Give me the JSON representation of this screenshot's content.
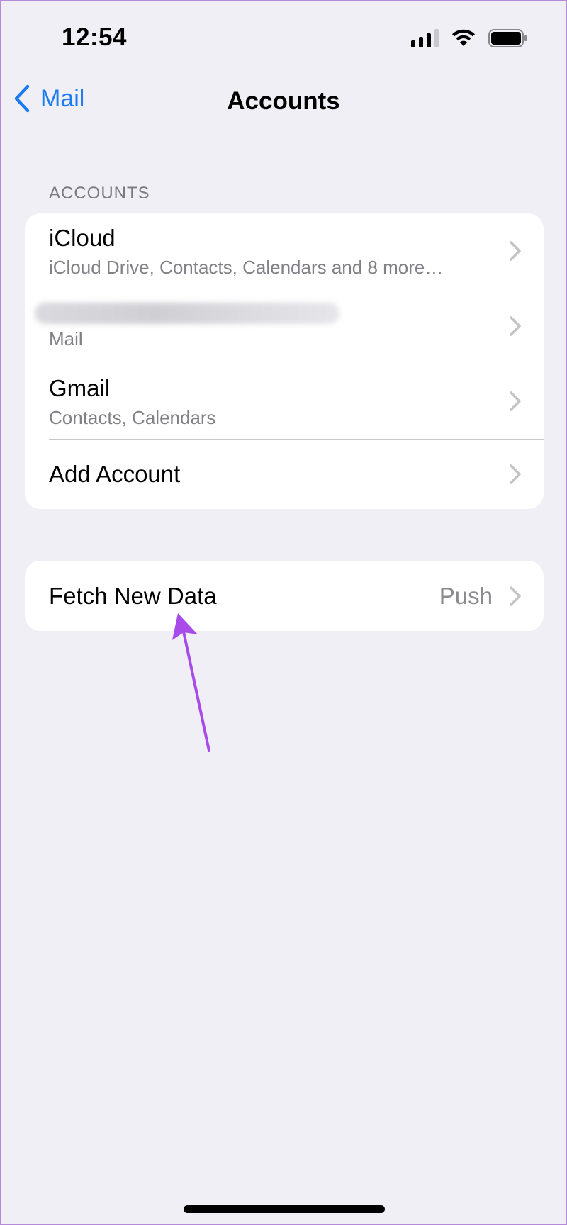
{
  "status_bar": {
    "time": "12:54"
  },
  "nav": {
    "back_label": "Mail",
    "title": "Accounts"
  },
  "accounts_section": {
    "header": "ACCOUNTS",
    "rows": [
      {
        "title": "iCloud",
        "subtitle": "iCloud Drive, Contacts, Calendars and 8 more…"
      },
      {
        "title": "",
        "subtitle": "Mail"
      },
      {
        "title": "Gmail",
        "subtitle": "Contacts, Calendars"
      },
      {
        "title": "Add Account"
      }
    ]
  },
  "fetch_section": {
    "title": "Fetch New Data",
    "value": "Push"
  },
  "colors": {
    "accent": "#1a7cf0",
    "annotation_arrow": "#a94be8",
    "background": "#f0eff5"
  }
}
